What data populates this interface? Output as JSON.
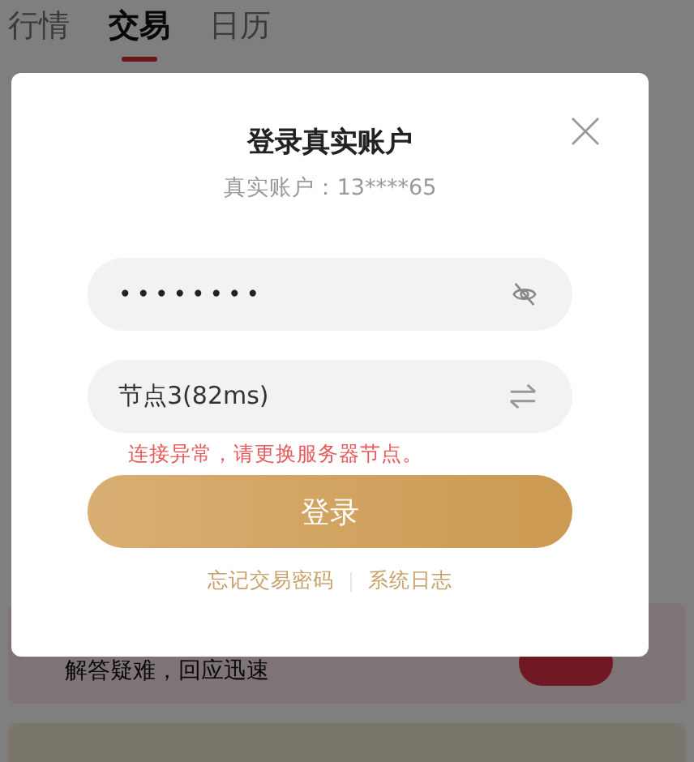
{
  "tabs": [
    {
      "label": "行情",
      "selected": false
    },
    {
      "label": "交易",
      "selected": true
    },
    {
      "label": "日历",
      "selected": false
    }
  ],
  "banner": {
    "text": "解答疑难，回应迅速"
  },
  "dialog": {
    "title": "登录真实账户",
    "account": "真实账户：13****65",
    "password": {
      "value": "••••••••",
      "masked": true
    },
    "server": {
      "value": "节点3(82ms)"
    },
    "error": "连接异常，请更换服务器节点。",
    "login_button": "登录",
    "links": [
      "忘记交易密码",
      "系统日志"
    ]
  }
}
